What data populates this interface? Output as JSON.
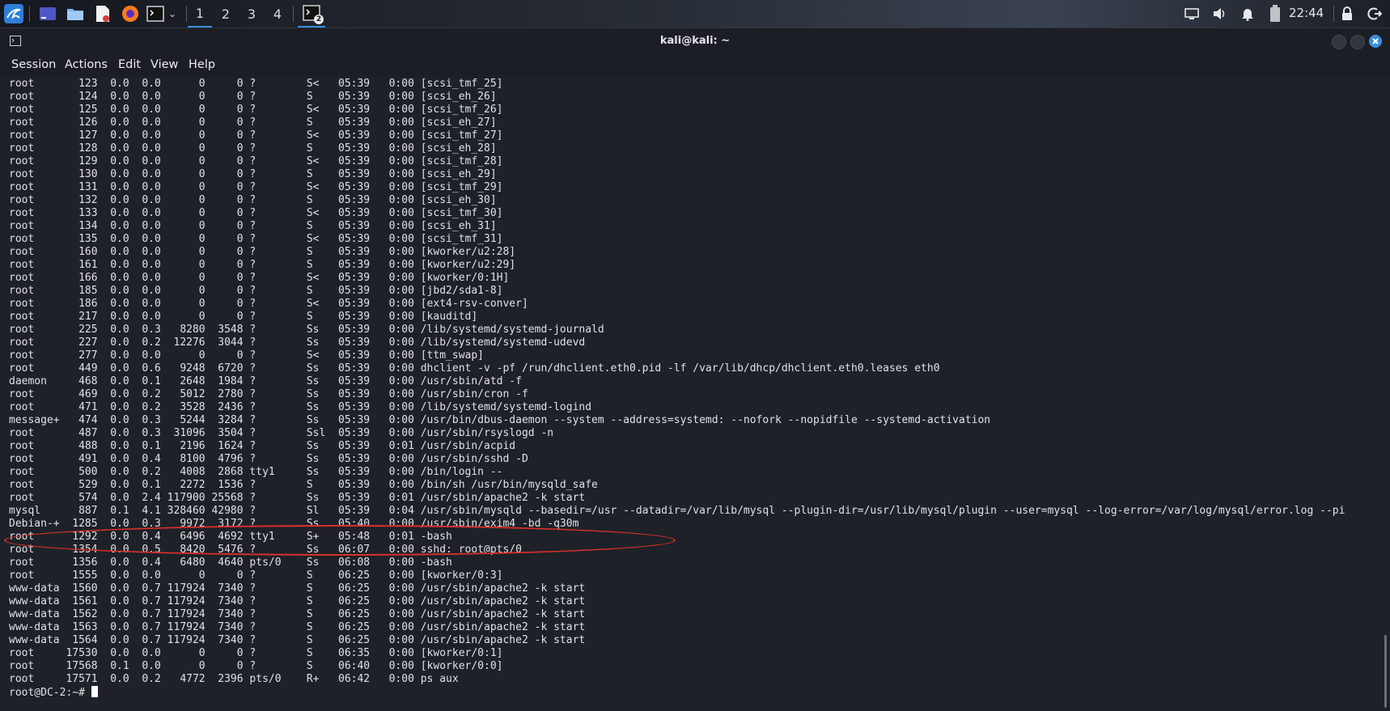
{
  "taskbar": {
    "workspaces": [
      "1",
      "2",
      "3",
      "4"
    ],
    "terminal_badge": "2",
    "clock": "22:44",
    "colors": {
      "active_workspace": "#3b8ddb"
    }
  },
  "window": {
    "title": "kali@kali: ~",
    "menu": [
      "Session",
      "Actions",
      "Edit",
      "View",
      "Help"
    ],
    "close_color": "#3b8ddb"
  },
  "terminal": {
    "lines": [
      "root       123  0.0  0.0      0     0 ?        S<   05:39   0:00 [scsi_tmf_25]",
      "root       124  0.0  0.0      0     0 ?        S    05:39   0:00 [scsi_eh_26]",
      "root       125  0.0  0.0      0     0 ?        S<   05:39   0:00 [scsi_tmf_26]",
      "root       126  0.0  0.0      0     0 ?        S    05:39   0:00 [scsi_eh_27]",
      "root       127  0.0  0.0      0     0 ?        S<   05:39   0:00 [scsi_tmf_27]",
      "root       128  0.0  0.0      0     0 ?        S    05:39   0:00 [scsi_eh_28]",
      "root       129  0.0  0.0      0     0 ?        S<   05:39   0:00 [scsi_tmf_28]",
      "root       130  0.0  0.0      0     0 ?        S    05:39   0:00 [scsi_eh_29]",
      "root       131  0.0  0.0      0     0 ?        S<   05:39   0:00 [scsi_tmf_29]",
      "root       132  0.0  0.0      0     0 ?        S    05:39   0:00 [scsi_eh_30]",
      "root       133  0.0  0.0      0     0 ?        S<   05:39   0:00 [scsi_tmf_30]",
      "root       134  0.0  0.0      0     0 ?        S    05:39   0:00 [scsi_eh_31]",
      "root       135  0.0  0.0      0     0 ?        S<   05:39   0:00 [scsi_tmf_31]",
      "root       160  0.0  0.0      0     0 ?        S    05:39   0:00 [kworker/u2:28]",
      "root       161  0.0  0.0      0     0 ?        S    05:39   0:00 [kworker/u2:29]",
      "root       166  0.0  0.0      0     0 ?        S<   05:39   0:00 [kworker/0:1H]",
      "root       185  0.0  0.0      0     0 ?        S    05:39   0:00 [jbd2/sda1-8]",
      "root       186  0.0  0.0      0     0 ?        S<   05:39   0:00 [ext4-rsv-conver]",
      "root       217  0.0  0.0      0     0 ?        S    05:39   0:00 [kauditd]",
      "root       225  0.0  0.3   8280  3548 ?        Ss   05:39   0:00 /lib/systemd/systemd-journald",
      "root       227  0.0  0.2  12276  3044 ?        Ss   05:39   0:00 /lib/systemd/systemd-udevd",
      "root       277  0.0  0.0      0     0 ?        S<   05:39   0:00 [ttm_swap]",
      "root       449  0.0  0.6   9248  6720 ?        Ss   05:39   0:00 dhclient -v -pf /run/dhclient.eth0.pid -lf /var/lib/dhcp/dhclient.eth0.leases eth0",
      "daemon     468  0.0  0.1   2648  1984 ?        Ss   05:39   0:00 /usr/sbin/atd -f",
      "root       469  0.0  0.2   5012  2780 ?        Ss   05:39   0:00 /usr/sbin/cron -f",
      "root       471  0.0  0.2   3528  2436 ?        Ss   05:39   0:00 /lib/systemd/systemd-logind",
      "message+   474  0.0  0.3   5244  3284 ?        Ss   05:39   0:00 /usr/bin/dbus-daemon --system --address=systemd: --nofork --nopidfile --systemd-activation",
      "root       487  0.0  0.3  31096  3504 ?        Ssl  05:39   0:00 /usr/sbin/rsyslogd -n",
      "root       488  0.0  0.1   2196  1624 ?        Ss   05:39   0:01 /usr/sbin/acpid",
      "root       491  0.0  0.4   8100  4796 ?        Ss   05:39   0:00 /usr/sbin/sshd -D",
      "root       500  0.0  0.2   4008  2868 tty1     Ss   05:39   0:00 /bin/login --",
      "root       529  0.0  0.1   2272  1536 ?        S    05:39   0:00 /bin/sh /usr/bin/mysqld_safe",
      "root       574  0.0  2.4 117900 25568 ?        Ss   05:39   0:01 /usr/sbin/apache2 -k start",
      "mysql      887  0.1  4.1 328460 42980 ?        Sl   05:39   0:04 /usr/sbin/mysqld --basedir=/usr --datadir=/var/lib/mysql --plugin-dir=/usr/lib/mysql/plugin --user=mysql --log-error=/var/log/mysql/error.log --pi",
      "Debian-+  1285  0.0  0.3   9972  3172 ?        Ss   05:40   0:00 /usr/sbin/exim4 -bd -q30m",
      "root      1292  0.0  0.4   6496  4692 tty1     S+   05:48   0:01 -bash",
      "root      1354  0.0  0.5   8420  5476 ?        Ss   06:07   0:00 sshd: root@pts/0",
      "root      1356  0.0  0.4   6480  4640 pts/0    Ss   06:08   0:00 -bash",
      "root      1555  0.0  0.0      0     0 ?        S    06:25   0:00 [kworker/0:3]",
      "www-data  1560  0.0  0.7 117924  7340 ?        S    06:25   0:00 /usr/sbin/apache2 -k start",
      "www-data  1561  0.0  0.7 117924  7340 ?        S    06:25   0:00 /usr/sbin/apache2 -k start",
      "www-data  1562  0.0  0.7 117924  7340 ?        S    06:25   0:00 /usr/sbin/apache2 -k start",
      "www-data  1563  0.0  0.7 117924  7340 ?        S    06:25   0:00 /usr/sbin/apache2 -k start",
      "www-data  1564  0.0  0.7 117924  7340 ?        S    06:25   0:00 /usr/sbin/apache2 -k start",
      "root     17530  0.0  0.0      0     0 ?        S    06:35   0:00 [kworker/0:1]",
      "root     17568  0.1  0.0      0     0 ?        S    06:40   0:00 [kworker/0:0]",
      "root     17571  0.0  0.2   4772  2396 pts/0    R+   06:42   0:00 ps aux"
    ],
    "prompt": "root@DC-2:~# ",
    "highlight_color": "#d9302b"
  }
}
